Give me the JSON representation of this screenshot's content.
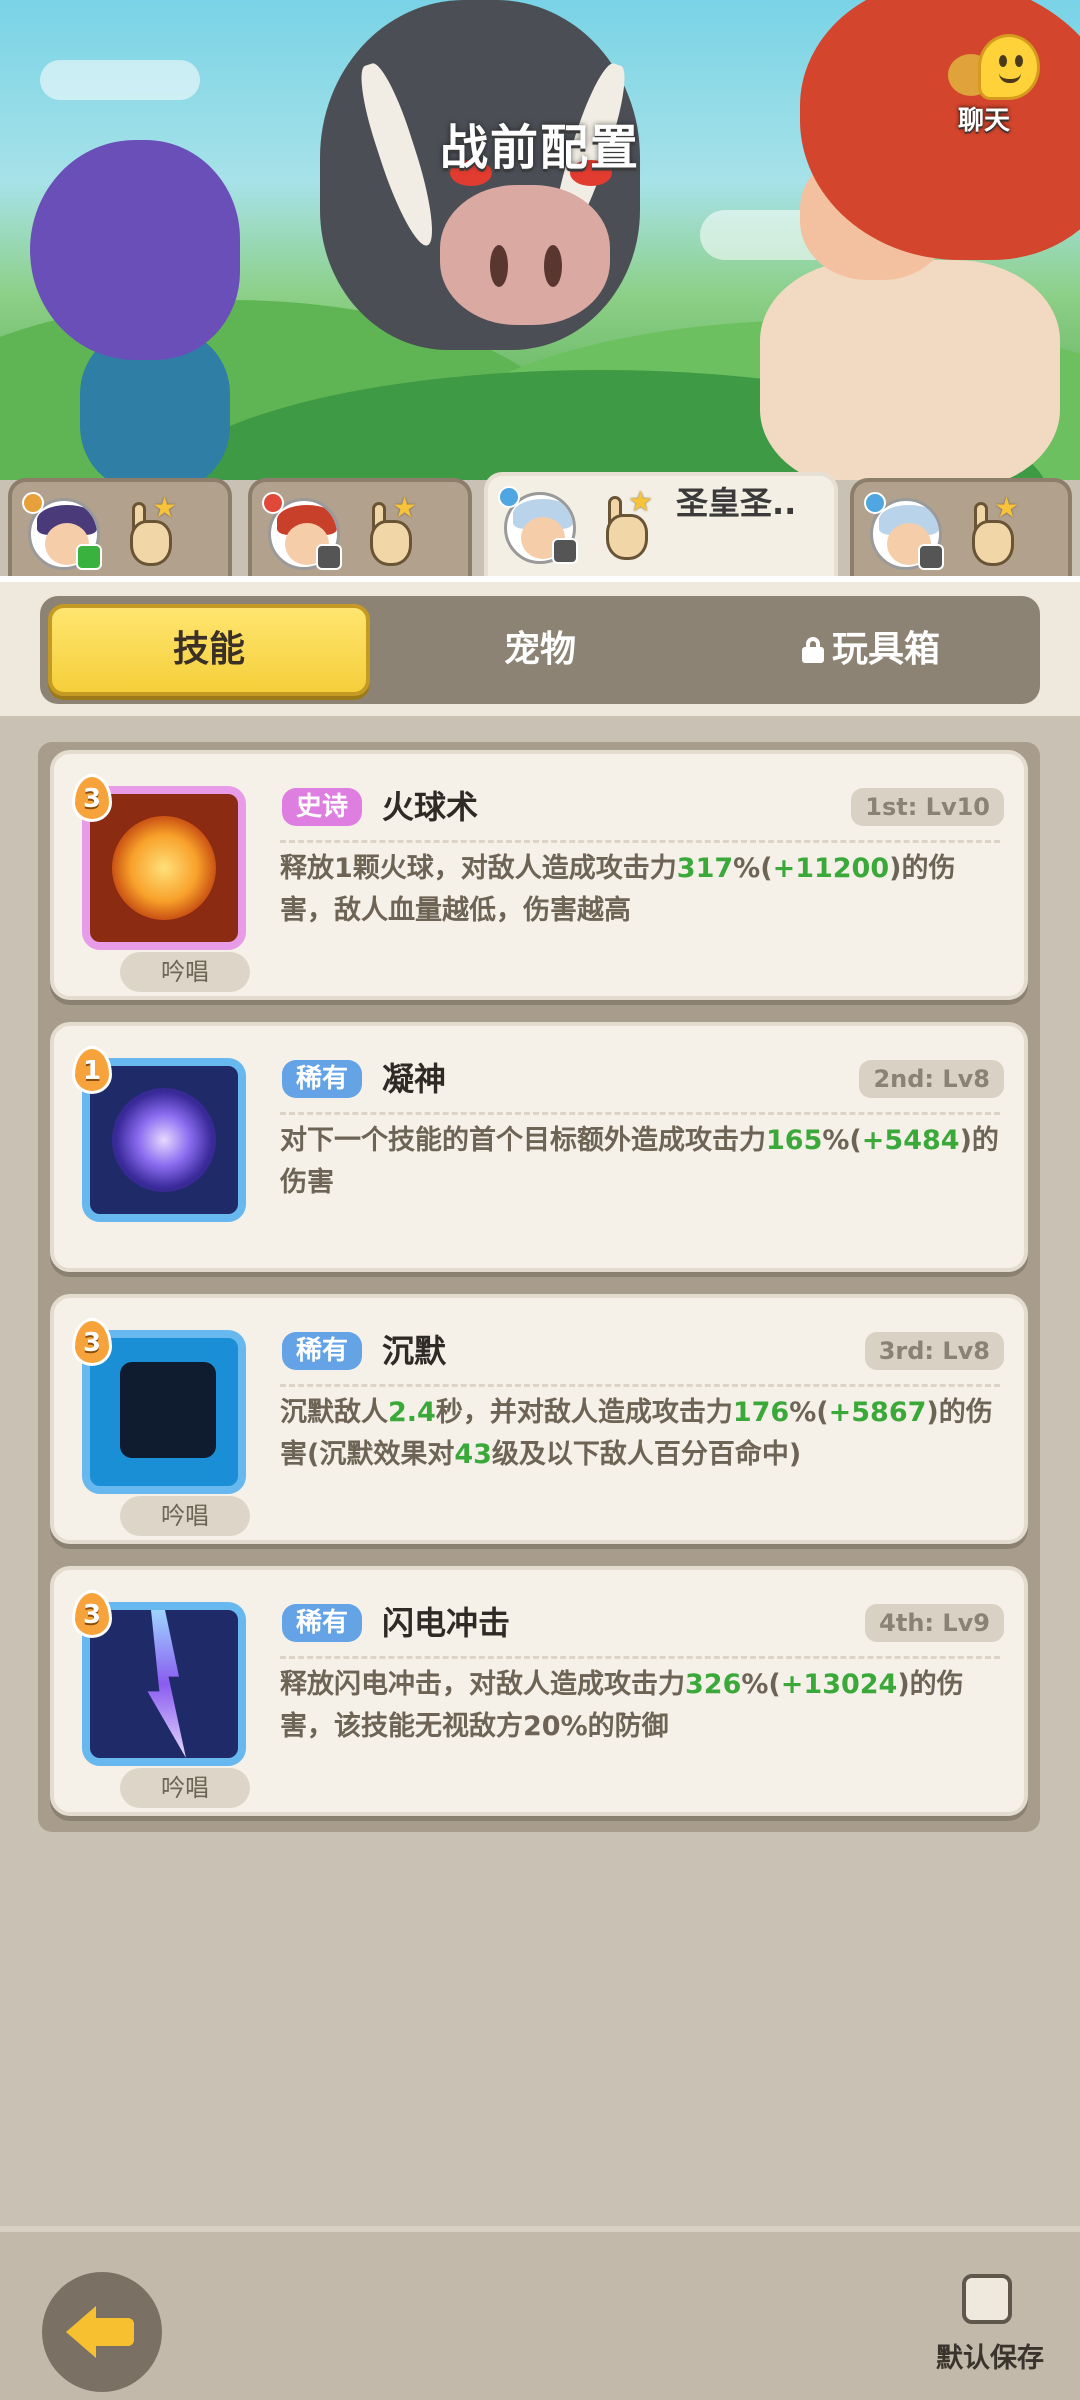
{
  "header": {
    "title": "战前配置",
    "chat_label": "聊天"
  },
  "hero_tabs": [
    {
      "name": "",
      "active": false,
      "type_badge": "green"
    },
    {
      "name": "",
      "active": false,
      "type_badge": "gray"
    },
    {
      "name": "圣皇圣..",
      "active": true,
      "type_badge": "gray"
    },
    {
      "name": "",
      "active": false,
      "type_badge": "gray"
    }
  ],
  "segment": {
    "skill": "技能",
    "pet": "宠物",
    "toybox": "玩具箱"
  },
  "skills": [
    {
      "level": "3",
      "rarity": "史诗",
      "name": "火球术",
      "slot": "1st: Lv10",
      "desc_1": "释放1颗火球，对敌人造成攻击力",
      "desc_v1": "317",
      "desc_2": "%(",
      "desc_v2": "+11200",
      "desc_3": ")的伤害，敌人血量越低，伤害越高",
      "chant": "吟唱"
    },
    {
      "level": "1",
      "rarity": "稀有",
      "name": "凝神",
      "slot": "2nd: Lv8",
      "desc_1": "对下一个技能的首个目标额外造成攻击力",
      "desc_v1": "165",
      "desc_2": "%(",
      "desc_v2": "+5484",
      "desc_3": ")的伤害",
      "chant": ""
    },
    {
      "level": "3",
      "rarity": "稀有",
      "name": "沉默",
      "slot": "3rd: Lv8",
      "desc_pre": "沉默敌人",
      "desc_v0": "2.4",
      "desc_mid": "秒，并对敌人造成攻击力",
      "desc_v1": "176",
      "desc_2": "%(",
      "desc_v2": "+5867",
      "desc_3": ")的伤害(沉默效果对",
      "desc_v3": "43",
      "desc_4": "级及以下敌人百分百命中)",
      "chant": "吟唱"
    },
    {
      "level": "3",
      "rarity": "稀有",
      "name": "闪电冲击",
      "slot": "4th: Lv9",
      "desc_1": "释放闪电冲击，对敌人造成攻击力",
      "desc_v1": "326",
      "desc_2": "%(",
      "desc_v2": "+13024",
      "desc_3": ")的伤害，该技能无视敌方20%的防御",
      "chant": "吟唱"
    }
  ],
  "footer": {
    "save_label": "默认保存",
    "save_checked": false
  },
  "colors": {
    "accent_yellow": "#f5cf3a",
    "epic": "#de7ee0",
    "rare": "#64a3e6",
    "value_green": "#3aa93a"
  }
}
